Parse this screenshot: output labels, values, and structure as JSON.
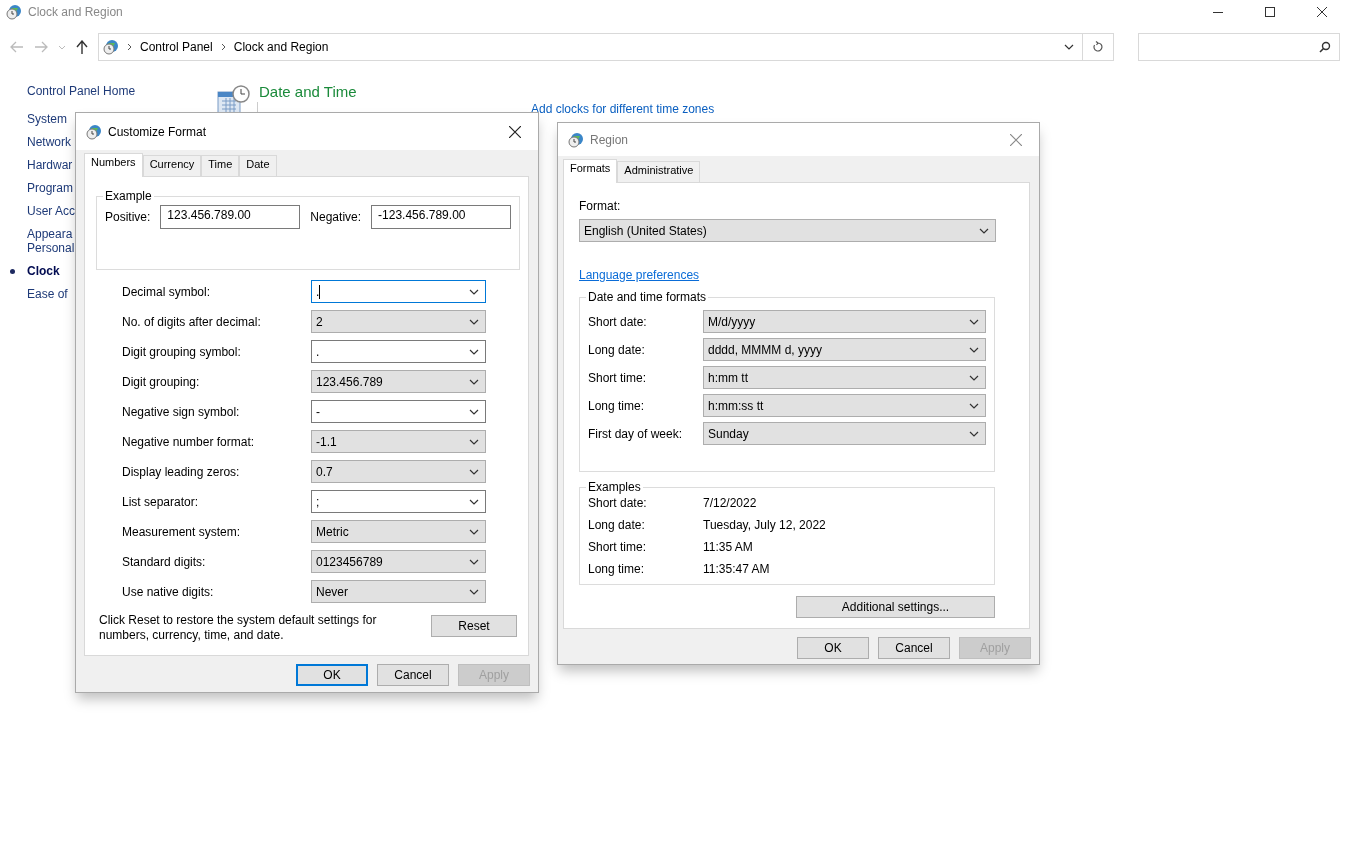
{
  "window": {
    "title": "Clock and Region"
  },
  "address_bar": {
    "crumbs": [
      "Control Panel",
      "Clock and Region"
    ]
  },
  "sidebar": {
    "home": "Control Panel Home",
    "items": [
      {
        "label": "System",
        "selected": false
      },
      {
        "label": "Network",
        "selected": false
      },
      {
        "label": "Hardwar",
        "selected": false
      },
      {
        "label": "Program",
        "selected": false
      },
      {
        "label": "User Acc",
        "selected": false
      },
      {
        "label": "Appeara\nPersonal",
        "selected": false
      },
      {
        "label": "Clock",
        "selected": true
      },
      {
        "label": "Ease of",
        "selected": false
      }
    ]
  },
  "main": {
    "heading": "Date and Time",
    "links": [
      "Add clocks for different time zones"
    ]
  },
  "customize_dialog": {
    "title": "Customize Format",
    "tabs": [
      {
        "label": "Numbers",
        "selected": true
      },
      {
        "label": "Currency",
        "selected": false
      },
      {
        "label": "Time",
        "selected": false
      },
      {
        "label": "Date",
        "selected": false
      }
    ],
    "example": {
      "title": "Example",
      "positive_label": "Positive:",
      "positive": "123.456.789.00",
      "negative_label": "Negative:",
      "negative": "-123.456.789.00"
    },
    "settings": [
      {
        "label": "Decimal symbol:",
        "value": ".",
        "kind": "editable",
        "focused": true
      },
      {
        "label": "No. of digits after decimal:",
        "value": "2",
        "kind": "list",
        "focused": false
      },
      {
        "label": "Digit grouping symbol:",
        "value": ".",
        "kind": "editable",
        "focused": false
      },
      {
        "label": "Digit grouping:",
        "value": "123.456.789",
        "kind": "list",
        "focused": false
      },
      {
        "label": "Negative sign symbol:",
        "value": "-",
        "kind": "editable",
        "focused": false
      },
      {
        "label": "Negative number format:",
        "value": "-1.1",
        "kind": "list",
        "focused": false
      },
      {
        "label": "Display leading zeros:",
        "value": "0.7",
        "kind": "list",
        "focused": false
      },
      {
        "label": "List separator:",
        "value": ";",
        "kind": "editable",
        "focused": false
      },
      {
        "label": "Measurement system:",
        "value": "Metric",
        "kind": "list",
        "focused": false
      },
      {
        "label": "Standard digits:",
        "value": "0123456789",
        "kind": "list",
        "focused": false
      },
      {
        "label": "Use native digits:",
        "value": "Never",
        "kind": "list",
        "focused": false
      }
    ],
    "note": "Click Reset to restore the system default settings for numbers, currency, time, and date.",
    "reset": "Reset",
    "buttons": [
      {
        "label": "OK",
        "default": true,
        "disabled": false
      },
      {
        "label": "Cancel",
        "default": false,
        "disabled": false
      },
      {
        "label": "Apply",
        "default": false,
        "disabled": true
      }
    ]
  },
  "region_dialog": {
    "title": "Region",
    "tabs": [
      {
        "label": "Formats",
        "selected": true
      },
      {
        "label": "Administrative",
        "selected": false
      }
    ],
    "format_label": "Format:",
    "format": "English (United States)",
    "language_link": "Language preferences",
    "formats_group": {
      "title": "Date and time formats",
      "rows": [
        {
          "label": "Short date:",
          "value": "M/d/yyyy"
        },
        {
          "label": "Long date:",
          "value": "dddd, MMMM d, yyyy"
        },
        {
          "label": "Short time:",
          "value": "h:mm tt"
        },
        {
          "label": "Long time:",
          "value": "h:mm:ss tt"
        },
        {
          "label": "First day of week:",
          "value": "Sunday"
        }
      ]
    },
    "examples_group": {
      "title": "Examples",
      "rows": [
        {
          "label": "Short date:",
          "value": "7/12/2022"
        },
        {
          "label": "Long date:",
          "value": "Tuesday, July 12, 2022"
        },
        {
          "label": "Short time:",
          "value": "11:35 AM"
        },
        {
          "label": "Long time:",
          "value": "11:35:47 AM"
        }
      ]
    },
    "additional": "Additional settings...",
    "buttons": [
      {
        "label": "OK",
        "default": false,
        "disabled": false
      },
      {
        "label": "Cancel",
        "default": false,
        "disabled": false
      },
      {
        "label": "Apply",
        "default": false,
        "disabled": true
      }
    ]
  }
}
